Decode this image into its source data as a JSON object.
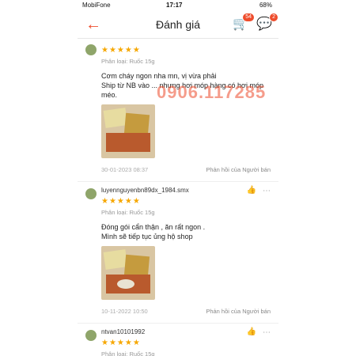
{
  "status": {
    "carrier": "MobiFone",
    "time": "17:17",
    "battery": "68%"
  },
  "nav": {
    "title": "Đánh giá",
    "cart_badge": "54",
    "chat_badge": "2",
    "icons": {
      "back": "arrow-left-icon",
      "cart": "cart-icon",
      "chat": "chat-icon"
    }
  },
  "watermark": "0906.117285",
  "reviews": [
    {
      "username": "",
      "stars": "★★★★★",
      "variant": "Phân loại: Ruốc 15g",
      "comment": "Cơm cháy ngon nha mn, vị vừa phải\nShip từ NB vào ... nhưng hơi móp hàng có hơi móp méo.",
      "date": "30-01-2023 08:37",
      "reply": "Phản hồi của Người bán"
    },
    {
      "username": "luyennguyenbn89dx_1984.smx",
      "stars": "★★★★★",
      "variant": "Phân loại: Ruốc 15g",
      "comment": "Đóng gói cẩn thận , ăn rất ngon .\nMình sẽ tiếp tục ủng hộ shop",
      "date": "10-11-2022 10:50",
      "reply": "Phản hồi của Người bán"
    },
    {
      "username": "ntvan10101992",
      "stars": "★★★★★",
      "variant": "Phân loại: Ruốc 15g"
    }
  ]
}
